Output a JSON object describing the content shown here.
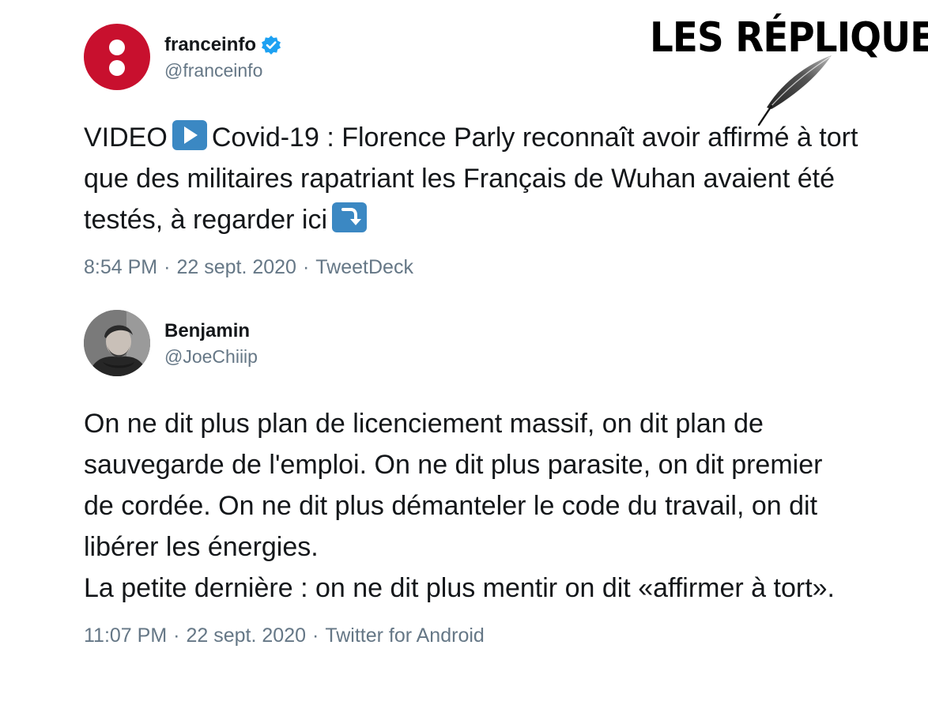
{
  "brand": {
    "title": "LES RÉPLIQUES",
    "icon": "quill-icon"
  },
  "tweet1": {
    "display_name": "franceinfo",
    "handle": "@franceinfo",
    "verified": true,
    "text_part1": "VIDEO",
    "text_part2": "Covid-19 : Florence Parly reconnaît avoir affirmé à tort que des militaires rapatriant les Français de Wuhan avaient été testés, à regarder ici",
    "emoji_play": "play-button-emoji",
    "emoji_arrow": "arrow-down-right-emoji",
    "time": "8:54 PM",
    "date": "22 sept. 2020",
    "source": "TweetDeck",
    "separator": "·"
  },
  "tweet2": {
    "display_name": "Benjamin",
    "handle": "@JoeChiiip",
    "text": "On ne dit plus plan de licenciement massif, on dit plan de sauvegarde de l'emploi. On ne dit plus parasite, on dit premier de cordée. On ne dit plus démanteler le code du travail, on dit libérer les énergies.\nLa petite dernière : on ne dit plus mentir on dit «affirmer à tort».",
    "time": "11:07 PM",
    "date": "22 sept. 2020",
    "source": "Twitter for Android",
    "separator": "·"
  },
  "colors": {
    "franceinfo_red": "#c8102e",
    "verified_blue": "#1da1f2",
    "emoji_blue": "#3b88c3",
    "meta_gray": "#657786",
    "text_dark": "#14171a"
  }
}
